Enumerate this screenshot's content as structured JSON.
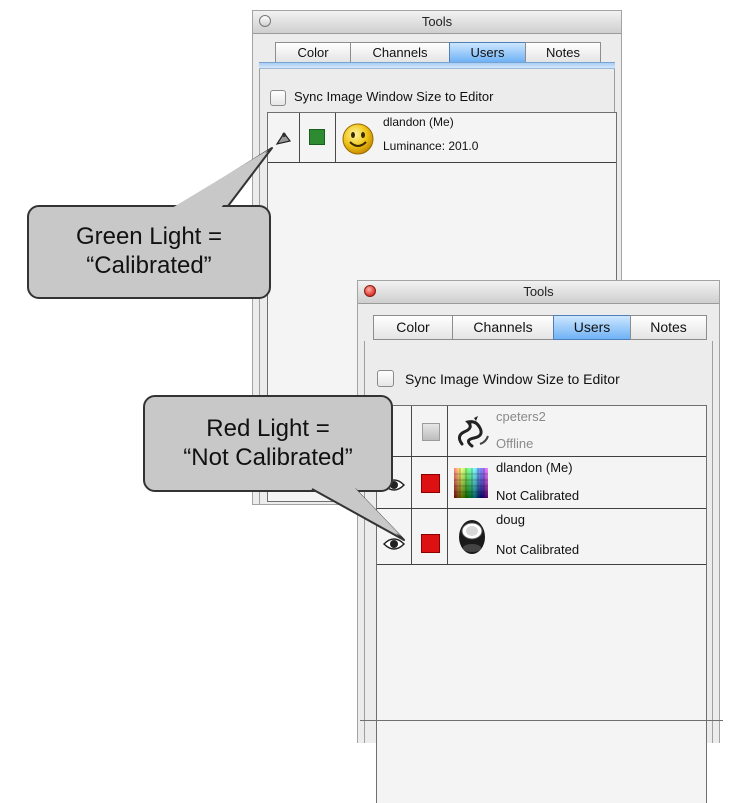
{
  "windows": [
    {
      "title": "Tools",
      "tabs": [
        "Color",
        "Channels",
        "Users",
        "Notes"
      ],
      "active_tab": "Users",
      "checkbox_label": "Sync Image Window Size to Editor",
      "users": [
        {
          "name": "dlandon (Me)",
          "status": "Luminance: 201.0",
          "light_color": "#2e8b32",
          "avatar_icon": "smiley-face-icon",
          "status_icon": "calibration-icon"
        }
      ]
    },
    {
      "title": "Tools",
      "tabs": [
        "Color",
        "Channels",
        "Users",
        "Notes"
      ],
      "active_tab": "Users",
      "checkbox_label": "Sync Image Window Size to Editor",
      "users": [
        {
          "name": "cpeters2",
          "status": "Offline",
          "light_color": "#cfcfcf",
          "avatar_icon": "dragon-icon",
          "status_icon": ""
        },
        {
          "name": "dlandon (Me)",
          "status": "Not Calibrated",
          "light_color": "#dd1111",
          "avatar_icon": "color-grid-icon",
          "status_icon": "eye-icon"
        },
        {
          "name": "doug",
          "status": "Not Calibrated",
          "light_color": "#dd1111",
          "avatar_icon": "camera-lens-icon",
          "status_icon": "eye-icon"
        }
      ]
    }
  ],
  "callouts": [
    {
      "line1": "Green Light =",
      "line2": "“Calibrated”"
    },
    {
      "line1": "Red Light =",
      "line2": "“Not Calibrated”"
    }
  ],
  "colors": {
    "green_light": "#2e8b32",
    "red_light": "#dd1111",
    "offline_light": "#cfcfcf",
    "active_tab": "#6fb2f5",
    "close_button_red": "#e0443a"
  }
}
